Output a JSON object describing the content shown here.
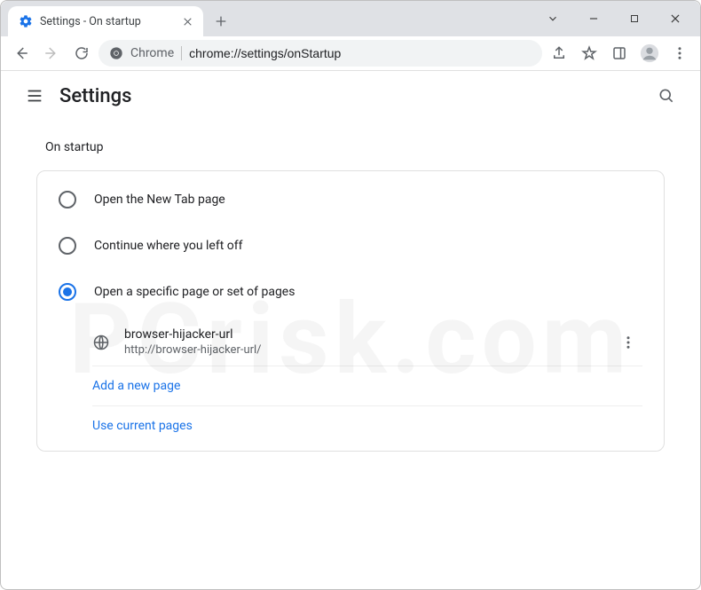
{
  "window": {
    "tab_title": "Settings - On startup"
  },
  "omnibox": {
    "scheme_label": "Chrome",
    "url": "chrome://settings/onStartup"
  },
  "header": {
    "title": "Settings"
  },
  "section": {
    "heading": "On startup"
  },
  "options": {
    "opt1": "Open the New Tab page",
    "opt2": "Continue where you left off",
    "opt3": "Open a specific page or set of pages"
  },
  "startup_page": {
    "title": "browser-hijacker-url",
    "url": "http://browser-hijacker-url/"
  },
  "links": {
    "add": "Add a new page",
    "use_current": "Use current pages"
  },
  "watermark": "PCrisk.com"
}
